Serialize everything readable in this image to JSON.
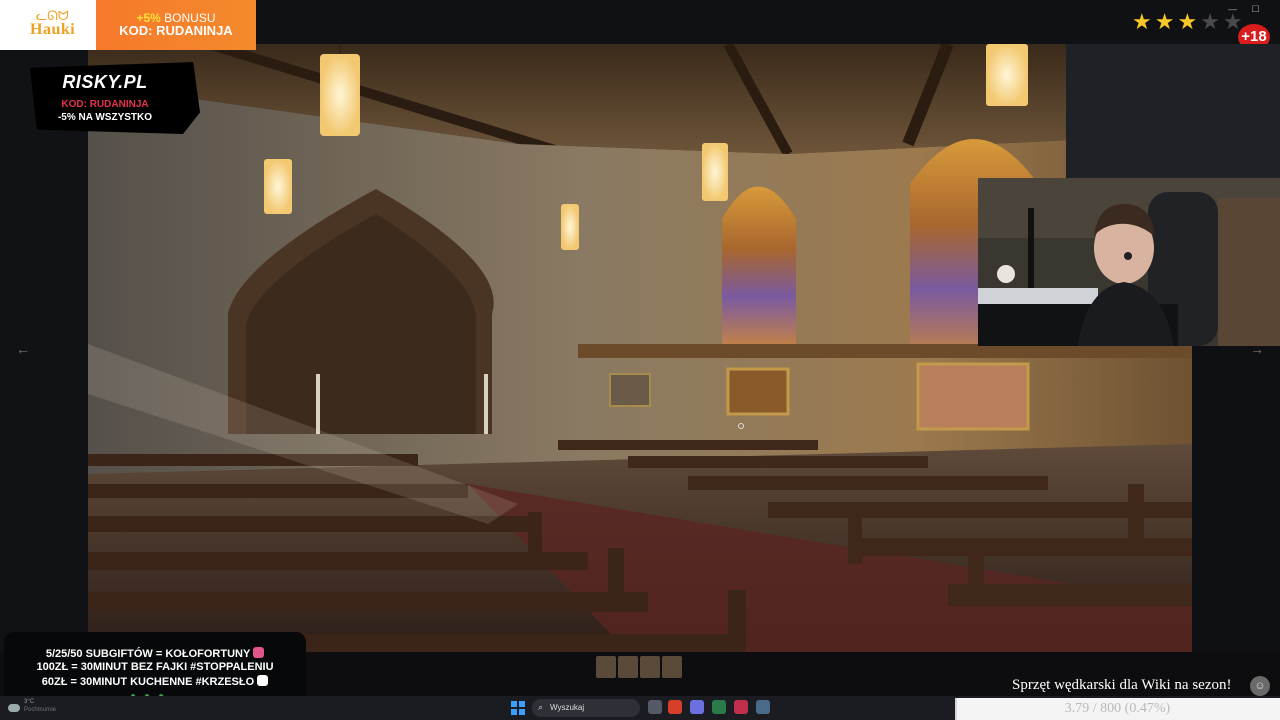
{
  "sponsor": {
    "brand": "Hauki",
    "bonus_prefix": "+5%",
    "bonus_word": "BONUSU",
    "bonus_code": "KOD: RUDANINJA"
  },
  "risky": {
    "logo": "RISKY.PL",
    "code": "KOD: RUDANINJA",
    "discount": "-5% NA WSZYSTKO"
  },
  "rating": {
    "filled": 3,
    "max": 5,
    "star_color": "#f7c628"
  },
  "age_badge": "+18",
  "goals": {
    "line1": "5/25/50 SUBGIFTÓW = KOŁOFORTUNY",
    "line2": "100ZŁ = 30MINUT BEZ FAJKI #STOPPALENIU",
    "line3": "60ZŁ = 30MINUT KUCHENNE #KRZESŁO"
  },
  "taskbar": {
    "search_placeholder": "Wyszukaj",
    "weather_temp": "3°C",
    "weather_condition": "Pochmurnie"
  },
  "ticker": "Sprzęt wędkarski dla Wiki na sezon!",
  "donation": {
    "label": "3.79 / 800 (0.47%)",
    "current": 3.79,
    "goal": 800,
    "percent": 0.47
  },
  "colors": {
    "accent_orange": "#f7792a",
    "risky_red": "#e8324c",
    "age_red": "#d91d1d",
    "windows_blue": "#3aa0ff"
  }
}
